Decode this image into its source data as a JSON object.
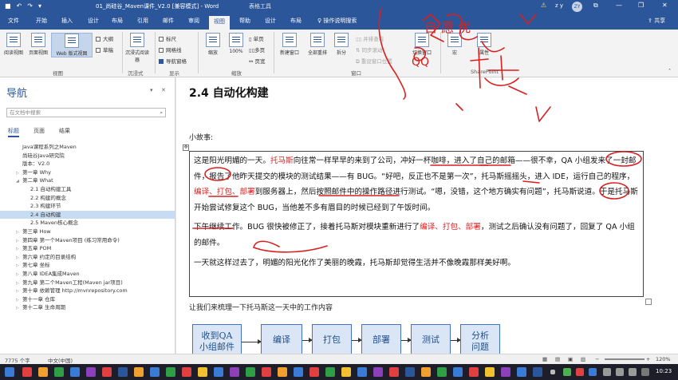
{
  "titlebar": {
    "doc_title": "01_尚硅谷_Maven课件_V2.0 [兼容模式] - Word",
    "context_tab": "表格工具",
    "warning_icon": "warning-icon",
    "user_name": "z y",
    "avatar_text": "ZY"
  },
  "tabs": [
    "文件",
    "开始",
    "插入",
    "设计",
    "布局",
    "引用",
    "邮件",
    "审阅",
    "视图",
    "帮助",
    "设计",
    "布局"
  ],
  "tell_me": "操作说明搜索",
  "share": "共享",
  "ribbon": {
    "read_mode": "阅读视图",
    "print_layout": "页面视图",
    "web_layout": "Web 版式视图",
    "outline": "大纲",
    "draft": "草稿",
    "group_views": "视图",
    "immersive_reader": "沉浸式阅读器",
    "group_immersive": "沉浸式",
    "ruler": "标尺",
    "gridlines": "网格线",
    "nav_pane": "导航窗格",
    "group_show": "显示",
    "zoom": "缩放",
    "zoom_100": "100%",
    "one_page": "单页",
    "multi_page": "多页",
    "page_width": "页宽",
    "group_zoom": "缩放",
    "new_window": "新建窗口",
    "arrange_all": "全部重排",
    "split": "拆分",
    "side_by_side": "并排查看",
    "sync_scroll": "同步滚动",
    "reset_position": "重设窗口位置",
    "switch_window": "切换窗口",
    "group_window": "窗口",
    "macros": "宏",
    "properties": "属性",
    "group_sharepoint": "SharePoint"
  },
  "nav": {
    "title": "导航",
    "search_placeholder": "在文档中搜索",
    "tabs": [
      "标题",
      "页面",
      "结果"
    ],
    "items": [
      {
        "label": "Java课程系列之Maven",
        "indent": 0
      },
      {
        "label": "尚硅谷Java研究院",
        "indent": 0
      },
      {
        "label": "版本：V2.0",
        "indent": 0
      },
      {
        "label": "第一章 Why",
        "indent": 0
      },
      {
        "label": "第二章 What",
        "indent": 0
      },
      {
        "label": "2.1 自动构建工具",
        "indent": 1
      },
      {
        "label": "2.2 构建的概念",
        "indent": 1
      },
      {
        "label": "2.3 构建环节",
        "indent": 1
      },
      {
        "label": "2.4 自动构建",
        "indent": 1
      },
      {
        "label": "2.5 Maven核心概念",
        "indent": 1
      },
      {
        "label": "第三章 How",
        "indent": 0
      },
      {
        "label": "第四章 第一个Maven项目 (练习常用命令)",
        "indent": 0
      },
      {
        "label": "第五章 POM",
        "indent": 0
      },
      {
        "label": "第六章 约定的目录结构",
        "indent": 0
      },
      {
        "label": "第七章 坐标",
        "indent": 0
      },
      {
        "label": "第八章 IDEA集成Maven",
        "indent": 0
      },
      {
        "label": "第九章 第二个Maven工程(Maven jar项目)",
        "indent": 0
      },
      {
        "label": "第十章 依赖管理 http://mvnrepository.com",
        "indent": 0
      },
      {
        "label": "第十一章 仓库",
        "indent": 0
      },
      {
        "label": "第十二章 生命周期",
        "indent": 0
      }
    ]
  },
  "doc": {
    "heading": "2.4 自动化构建",
    "story_label": "小故事:",
    "p1_a": "这是阳光明媚的一天。",
    "p1_b": "托马斯",
    "p1_c": "向往常一样早早的来到了公司，冲好一杯咖啡，进入了自己的邮箱——很不幸，QA 小组发来了一封邮件，报告了他昨天提交的模块的测试结果——有 BUG。“好吧，反正也不是第一次”，托马斯摇摇头，进入 IDE，运行自己的程序，",
    "p1_d": "编译、打包、部署",
    "p1_e": "到服务器上，然后按照邮件中的操作路径进行测试。“嗯，没错，这个地方确实有问题”，托马斯说道。于是托马斯开始尝试修复这个 BUG，当他差不多有眉目的时候已经到了午饭时间。",
    "p2_a": "下午继续工作。BUG 很快被修正了，接着托马斯对模块重新进行了",
    "p2_b": "编译、打包、部署",
    "p2_c": "，测试之后确认没有问题了，回复了 QA 小组的邮件。",
    "p3": "一天就这样过去了，明媚的阳光化作了美丽的晚霞，托马斯却觉得生活并不像晚霞那样美好啊。",
    "intro": "让我们来梳理一下托马斯这一天中的工作内容",
    "flow": [
      "收到QA\n小组邮件",
      "编译",
      "打包",
      "部署",
      "测试",
      "分析\n问题"
    ]
  },
  "status": {
    "words": "7775 个字",
    "lang": "中文(中国)",
    "zoom": "120%"
  },
  "taskbar": {
    "time": "10:23"
  },
  "annotations": {
    "ink_color": "#d82020",
    "note_left": "QQ",
    "note_right": "自 愿 优"
  }
}
